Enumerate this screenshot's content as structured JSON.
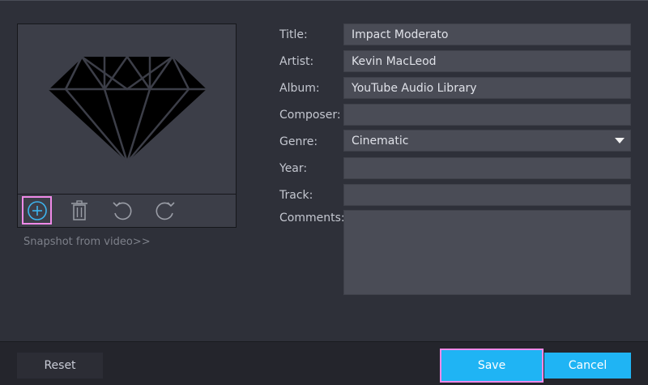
{
  "art": {
    "toolbar": {
      "add_icon": "plus-circle-icon",
      "delete_icon": "trash-icon",
      "rotate_left_icon": "rotate-left-icon",
      "rotate_right_icon": "rotate-right-icon"
    },
    "snapshot_link": "Snapshot from video>>"
  },
  "form": {
    "title_label": "Title:",
    "title_value": "Impact Moderato",
    "artist_label": "Artist:",
    "artist_value": "Kevin MacLeod",
    "album_label": "Album:",
    "album_value": "YouTube Audio Library",
    "composer_label": "Composer:",
    "composer_value": "",
    "genre_label": "Genre:",
    "genre_value": "Cinematic",
    "year_label": "Year:",
    "year_value": "",
    "track_label": "Track:",
    "track_value": "",
    "comments_label": "Comments:",
    "comments_value": ""
  },
  "footer": {
    "reset_label": "Reset",
    "save_label": "Save",
    "cancel_label": "Cancel"
  },
  "colors": {
    "background": "#2e3039",
    "field": "#4a4c56",
    "accent": "#1fb4f4",
    "highlight": "#ef8ae8"
  }
}
